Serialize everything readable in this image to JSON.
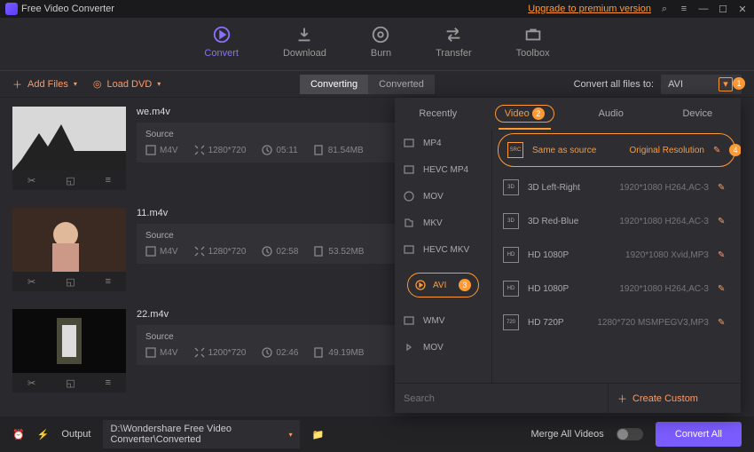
{
  "title": "Free Video Converter",
  "upgrade": "Upgrade to premium version",
  "tabs": {
    "convert": "Convert",
    "download": "Download",
    "burn": "Burn",
    "transfer": "Transfer",
    "toolbox": "Toolbox"
  },
  "toolbar": {
    "add": "Add Files",
    "load": "Load DVD",
    "converting": "Converting",
    "converted": "Converted",
    "convert_all_to": "Convert all files to:",
    "fmt": "AVI"
  },
  "markers": {
    "m1": "1",
    "m2": "2",
    "m3": "3",
    "m4": "4"
  },
  "files": [
    {
      "name": "we.m4v",
      "source": "Source",
      "fmt": "M4V",
      "res": "1280*720",
      "dur": "05:11",
      "size": "81.54MB"
    },
    {
      "name": "11.m4v",
      "source": "Source",
      "fmt": "M4V",
      "res": "1280*720",
      "dur": "02:58",
      "size": "53.52MB"
    },
    {
      "name": "22.m4v",
      "source": "Source",
      "fmt": "M4V",
      "res": "1200*720",
      "dur": "02:46",
      "size": "49.19MB"
    }
  ],
  "popover": {
    "tabs": {
      "recently": "Recently",
      "video": "Video",
      "audio": "Audio",
      "device": "Device"
    },
    "fmts": [
      "MP4",
      "HEVC MP4",
      "MOV",
      "MKV",
      "HEVC MKV",
      "AVI",
      "WMV",
      "MOV"
    ],
    "active_fmt": "AVI",
    "res": [
      {
        "name": "Same as source",
        "sub": "Original Resolution"
      },
      {
        "name": "3D Left-Right",
        "sub": "1920*1080 H264,AC-3"
      },
      {
        "name": "3D Red-Blue",
        "sub": "1920*1080 H264,AC-3"
      },
      {
        "name": "HD 1080P",
        "sub": "1920*1080 Xvid,MP3"
      },
      {
        "name": "HD 1080P",
        "sub": "1920*1080 H264,AC-3"
      },
      {
        "name": "HD 720P",
        "sub": "1280*720 MSMPEGV3,MP3"
      }
    ],
    "search_ph": "Search",
    "create": "Create Custom"
  },
  "bottom": {
    "output": "Output",
    "path": "D:\\Wondershare Free Video Converter\\Converted",
    "merge": "Merge All Videos",
    "convert": "Convert All"
  }
}
